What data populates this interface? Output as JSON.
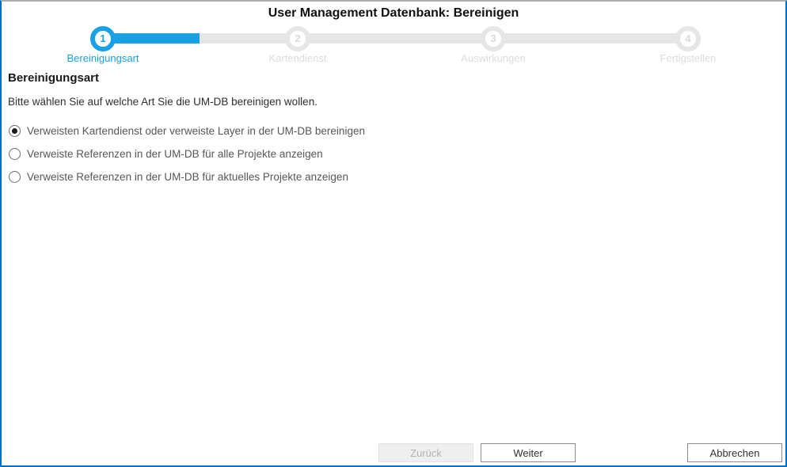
{
  "colors": {
    "accent": "#18A1E5",
    "window_border": "#0072C6",
    "top_border": "#ACACAC",
    "inactive_track": "#E6E6E6"
  },
  "header": {
    "title": "User Management Datenbank: Bereinigen"
  },
  "steps": {
    "progress_percent": 17,
    "items": [
      {
        "number": "1",
        "label": "Bereinigungsart",
        "state": "active"
      },
      {
        "number": "2",
        "label": "Kartendienst",
        "state": "pending"
      },
      {
        "number": "3",
        "label": "Auswirkungen",
        "state": "pending"
      },
      {
        "number": "4",
        "label": "Fertigstellen",
        "state": "pending"
      }
    ]
  },
  "content": {
    "heading": "Bereinigungsart",
    "instruction": "Bitte wählen Sie auf welche Art Sie die UM-DB bereinigen wollen.",
    "options": [
      {
        "label": "Verweisten Kartendienst oder verweiste Layer in der UM-DB bereinigen",
        "selected": true
      },
      {
        "label": "Verweiste Referenzen in der UM-DB für alle Projekte anzeigen",
        "selected": false
      },
      {
        "label": "Verweiste Referenzen in der UM-DB für aktuelles Projekte anzeigen",
        "selected": false
      }
    ]
  },
  "footer": {
    "back_label": "Zurück",
    "back_enabled": false,
    "next_label": "Weiter",
    "cancel_label": "Abbrechen"
  }
}
